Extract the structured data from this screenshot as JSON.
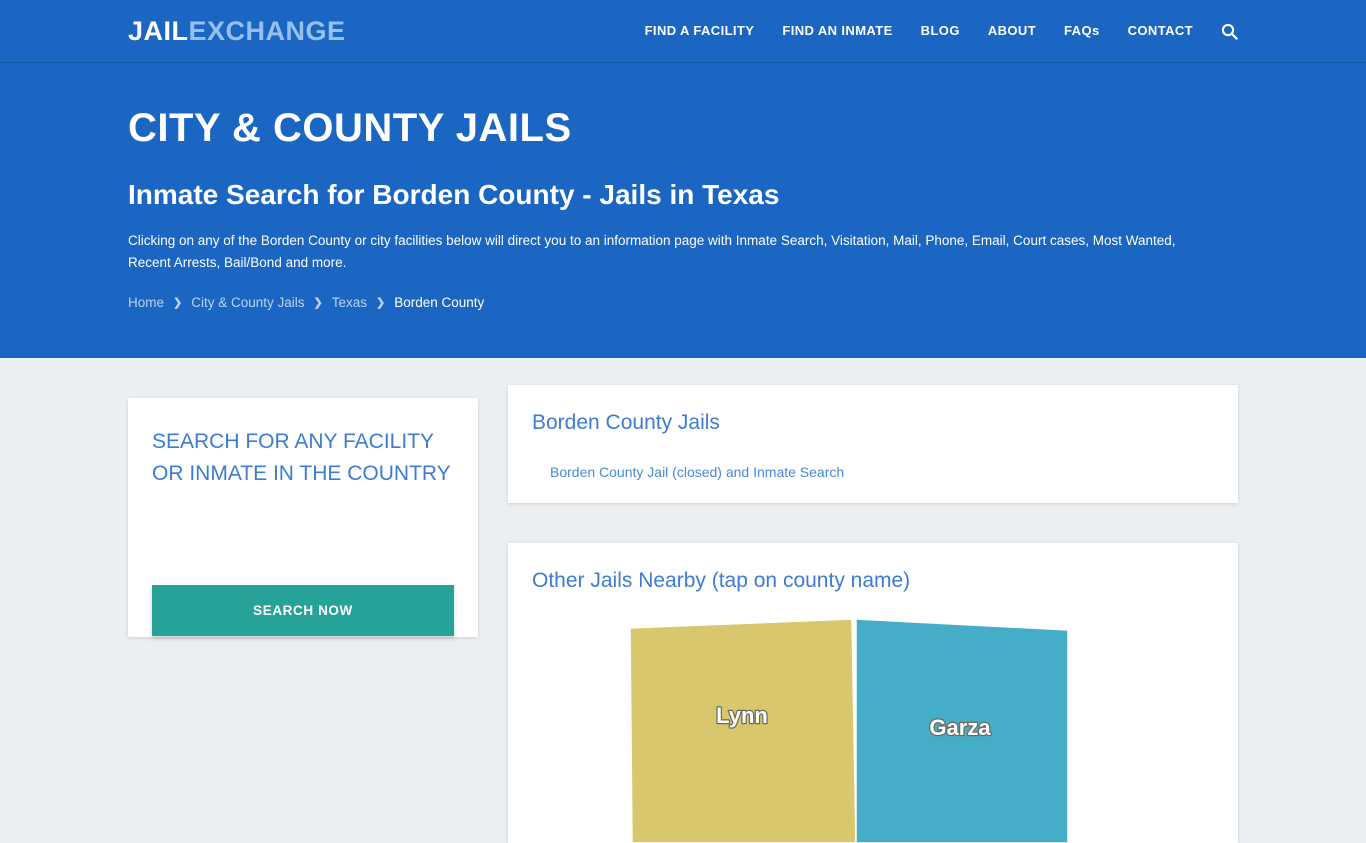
{
  "site": {
    "logo_primary": "JAIL",
    "logo_secondary": "EXCHANGE",
    "brand_blue": "#1a66c2",
    "accent_teal": "#27a299",
    "link_blue": "#3d7cd0"
  },
  "nav": {
    "items": [
      {
        "label": "FIND A FACILITY",
        "name": "nav-find-a-facility"
      },
      {
        "label": "FIND AN INMATE",
        "name": "nav-find-an-inmate"
      },
      {
        "label": "BLOG",
        "name": "nav-blog"
      },
      {
        "label": "ABOUT",
        "name": "nav-about"
      },
      {
        "label": "FAQs",
        "name": "nav-faqs"
      },
      {
        "label": "CONTACT",
        "name": "nav-contact"
      }
    ],
    "search_icon": "search-icon"
  },
  "hero": {
    "title": "CITY & COUNTY JAILS",
    "subtitle": "Inmate Search for Borden County - Jails in Texas",
    "description": "Clicking on any of the Borden County or city facilities below will direct you to an information page with Inmate Search, Visitation, Mail, Phone, Email, Court cases, Most Wanted, Recent Arrests, Bail/Bond and more."
  },
  "breadcrumb": {
    "items": [
      {
        "label": "Home"
      },
      {
        "label": "City & County Jails"
      },
      {
        "label": "Texas"
      }
    ],
    "current": "Borden County",
    "separator": "❯"
  },
  "search_card": {
    "title": "SEARCH FOR ANY FACILITY OR INMATE IN THE COUNTRY",
    "button_label": "SEARCH NOW"
  },
  "jails_card": {
    "title": "Borden County Jails",
    "links": [
      {
        "label": "Borden County Jail (closed) and Inmate Search"
      }
    ]
  },
  "nearby_card": {
    "title": "Other Jails Nearby (tap on county name)",
    "counties": [
      {
        "label": "Lynn",
        "color": "#d8c76c"
      },
      {
        "label": "Garza",
        "color": "#46adc9"
      }
    ]
  }
}
